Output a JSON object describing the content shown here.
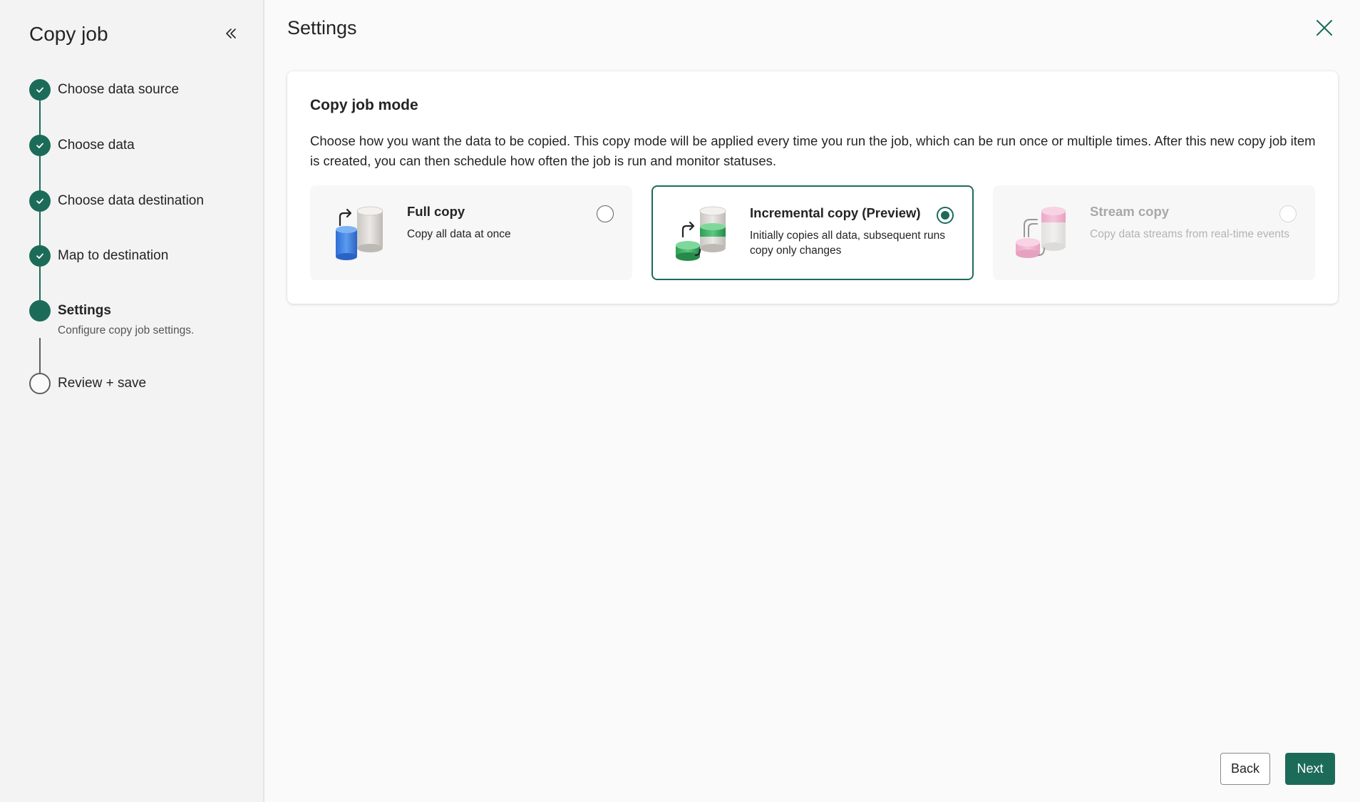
{
  "sidebar": {
    "title": "Copy job",
    "steps": [
      {
        "label": "Choose data source",
        "status": "complete"
      },
      {
        "label": "Choose data",
        "status": "complete"
      },
      {
        "label": "Choose data destination",
        "status": "complete"
      },
      {
        "label": "Map to destination",
        "status": "complete"
      },
      {
        "label": "Settings",
        "sub": "Configure copy job settings.",
        "status": "current"
      },
      {
        "label": "Review + save",
        "status": "pending"
      }
    ]
  },
  "main": {
    "title": "Settings",
    "card": {
      "title": "Copy job mode",
      "description": "Choose how you want the data to be copied. This copy mode will be applied every time you run the job, which can be run once or multiple times. After this new copy job item is created, you can then schedule how often the job is run and monitor statuses.",
      "options": [
        {
          "title": "Full copy",
          "description": "Copy all data at once",
          "selected": false,
          "disabled": false,
          "icon": "database-copy-icon"
        },
        {
          "title": "Incremental copy (Preview)",
          "description": "Initially copies all data, subsequent runs copy only changes",
          "selected": true,
          "disabled": false,
          "icon": "database-incremental-icon"
        },
        {
          "title": "Stream copy",
          "description": "Copy data streams from real-time events",
          "selected": false,
          "disabled": true,
          "icon": "database-stream-icon"
        }
      ]
    }
  },
  "footer": {
    "back_label": "Back",
    "next_label": "Next"
  },
  "colors": {
    "accent": "#1c6b59",
    "sidebar_bg": "#f3f3f3",
    "page_bg": "#fafafa"
  }
}
